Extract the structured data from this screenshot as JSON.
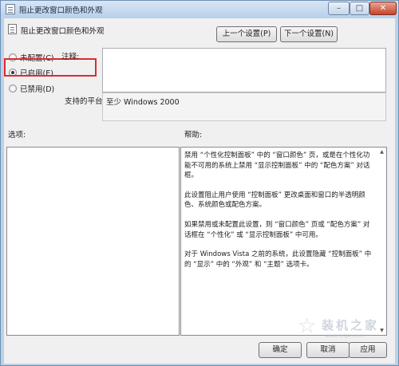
{
  "window": {
    "title": "阻止更改窗口颜色和外观",
    "minimize_glyph": "–",
    "maximize_glyph": "□",
    "close_glyph": "✕"
  },
  "header": {
    "title": "阻止更改窗口颜色和外观",
    "prev_label": "上一个设置(P)",
    "next_label": "下一个设置(N)"
  },
  "state_options": [
    {
      "label": "未配置(C)",
      "selected": false
    },
    {
      "label": "已启用(E)",
      "selected": true
    },
    {
      "label": "已禁用(D)",
      "selected": false
    }
  ],
  "comment": {
    "label": "注释:",
    "value": ""
  },
  "supported": {
    "label": "支持的平台:",
    "value": "至少 Windows 2000"
  },
  "options": {
    "label": "选项:"
  },
  "help": {
    "label": "帮助:",
    "paragraphs": [
      "禁用 “个性化控制面板” 中的 “窗口颜色” 页，或是在个性化功能不可用的系统上禁用 “显示控制面板” 中的 “配色方案” 对话框。",
      "此设置阻止用户使用 “控制面板” 更改桌面和窗口的半透明颜色、系统颜色或配色方案。",
      "如果禁用或未配置此设置，则 “窗口颜色” 页或 “配色方案” 对话框在 “个性化” 或 “显示控制面板” 中可用。",
      "对于 Windows Vista 之前的系统，此设置隐藏 “控制面板” 中的 “显示” 中的 “外观” 和 “主题” 选项卡。"
    ]
  },
  "footer": {
    "ok_label": "确定",
    "cancel_label": "取消",
    "apply_label": "应用"
  },
  "watermark": {
    "text": "装机之家",
    "url": "www.lotpc.com"
  }
}
